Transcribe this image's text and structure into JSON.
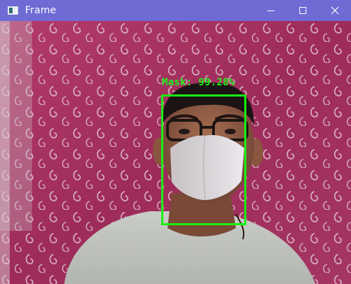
{
  "window": {
    "title": "Frame",
    "titlebar_color": "#6e6bd5",
    "icons": {
      "app": "app-window-icon",
      "minimize": "minimize-icon",
      "maximize": "maximize-icon",
      "close": "close-icon"
    }
  },
  "detection": {
    "label": "Mask: 99.28%",
    "class": "Mask",
    "confidence_percent": 99.28,
    "box_color": "#19f012"
  },
  "scene": {
    "background_color": "#a0305d",
    "pattern_color": "#e9d7e2"
  }
}
